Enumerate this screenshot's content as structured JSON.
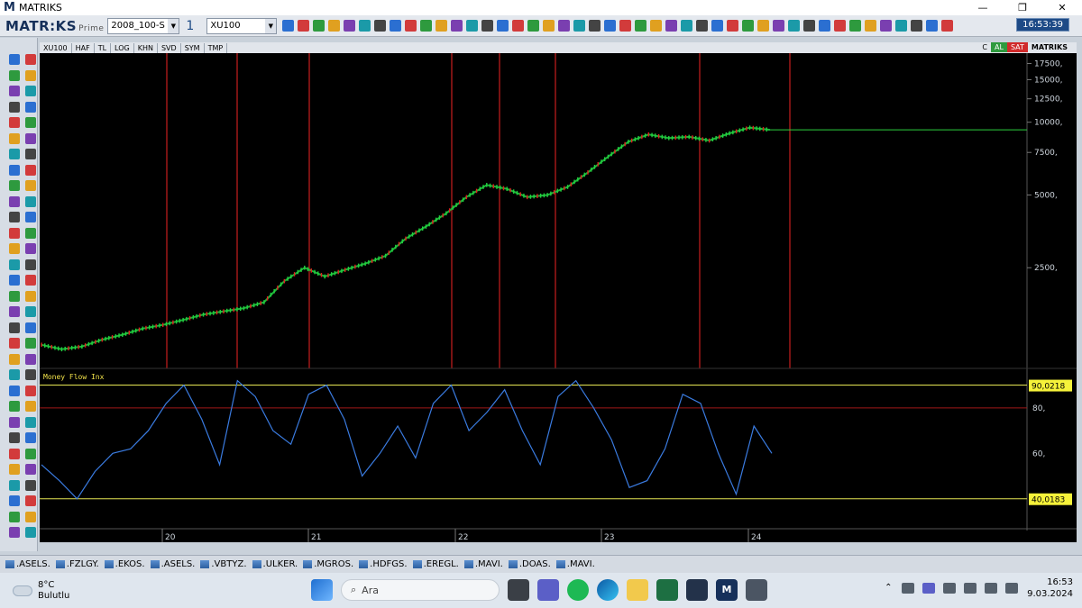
{
  "window": {
    "title": "MATRIKS",
    "minimize": "—",
    "restore": "❐",
    "close": "✕"
  },
  "toolbar": {
    "brand": "MATR:KS",
    "brand_suffix": "Prime",
    "template": "2008_100-S",
    "count": "1",
    "symbol": "XU100",
    "clock": "16:53:39"
  },
  "tabs": [
    "XU100",
    "HAF",
    "TL",
    "LOG",
    "KHN",
    "SVD",
    "SYM",
    "TMP"
  ],
  "tab_right": [
    "C",
    "AL",
    "SAT",
    "MATRIKS"
  ],
  "chart_data": [
    {
      "type": "line",
      "title": "XU100",
      "y_axis": "log",
      "y_ticks": [
        "17500,",
        "15000,",
        "12500,",
        "10000,",
        "7500,",
        "5000,",
        "2500,"
      ],
      "last_value": 9300,
      "x_ticks": [
        "20",
        "21",
        "22",
        "23",
        "24"
      ],
      "series": [
        {
          "values": [
            1200,
            1150,
            1180,
            1260,
            1320,
            1400,
            1450,
            1520,
            1600,
            1650,
            1700,
            1800,
            2200,
            2500,
            2300,
            2450,
            2600,
            2800,
            3300,
            3700,
            4200,
            4900,
            5500,
            5300,
            4900,
            5000,
            5400,
            6200,
            7200,
            8300,
            8900,
            8600,
            8700,
            8400,
            9000,
            9500,
            9300
          ]
        }
      ]
    },
    {
      "type": "line",
      "title": "Money Flow Inx",
      "upper_level": "90,0218",
      "lower_level": "40,0183",
      "y_ticks": [
        "80,",
        "60,"
      ],
      "series": [
        {
          "values": [
            55,
            48,
            40,
            52,
            60,
            62,
            70,
            82,
            90,
            75,
            55,
            92,
            85,
            70,
            64,
            86,
            90,
            75,
            50,
            60,
            72,
            58,
            82,
            90,
            70,
            78,
            88,
            70,
            55,
            85,
            92,
            80,
            66,
            45,
            48,
            62,
            86,
            82,
            60,
            42,
            72,
            60
          ]
        }
      ]
    }
  ],
  "bottom_tabs": [
    ".ASELS.",
    ".FZLGY.",
    ".EKOS.",
    ".ASELS.",
    ".VBTYZ.",
    ".ULKER.",
    ".MGROS.",
    ".HDFGS.",
    ".EREGL.",
    ".MAVI.",
    ".DOAS.",
    ".MAVI."
  ],
  "taskbar": {
    "temp": "8°C",
    "weather": "Bulutlu",
    "search": "Ara",
    "time": "16:53",
    "date": "9.03.2024"
  }
}
